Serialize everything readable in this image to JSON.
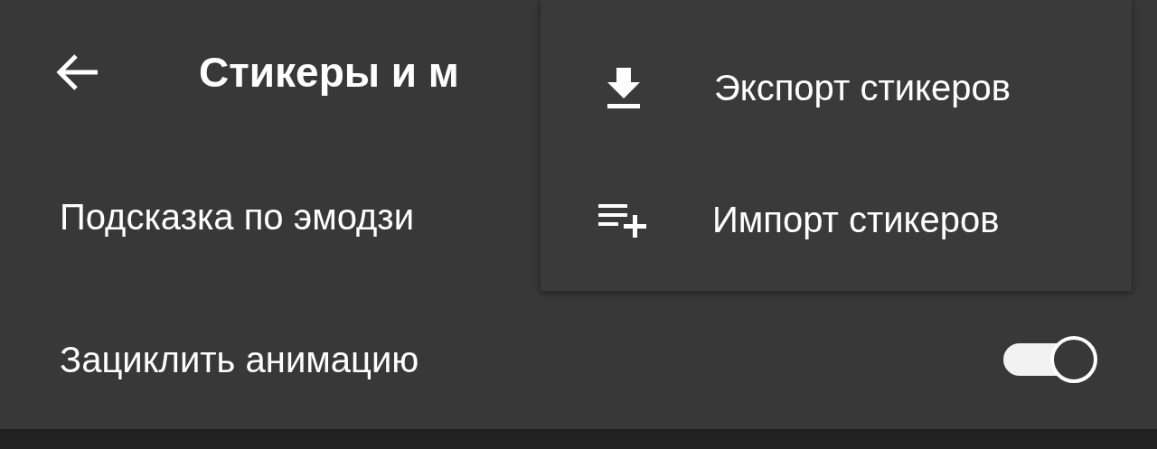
{
  "header": {
    "title": "Стикеры и м"
  },
  "settings": [
    {
      "kind": "plain",
      "label": "Подсказка по эмодзи"
    },
    {
      "kind": "switch",
      "label": "Зациклить анимацию",
      "on": true
    }
  ],
  "menu": [
    {
      "kind": "export",
      "label": "Экспорт стикеров"
    },
    {
      "kind": "import",
      "label": "Импорт стикеров"
    }
  ]
}
